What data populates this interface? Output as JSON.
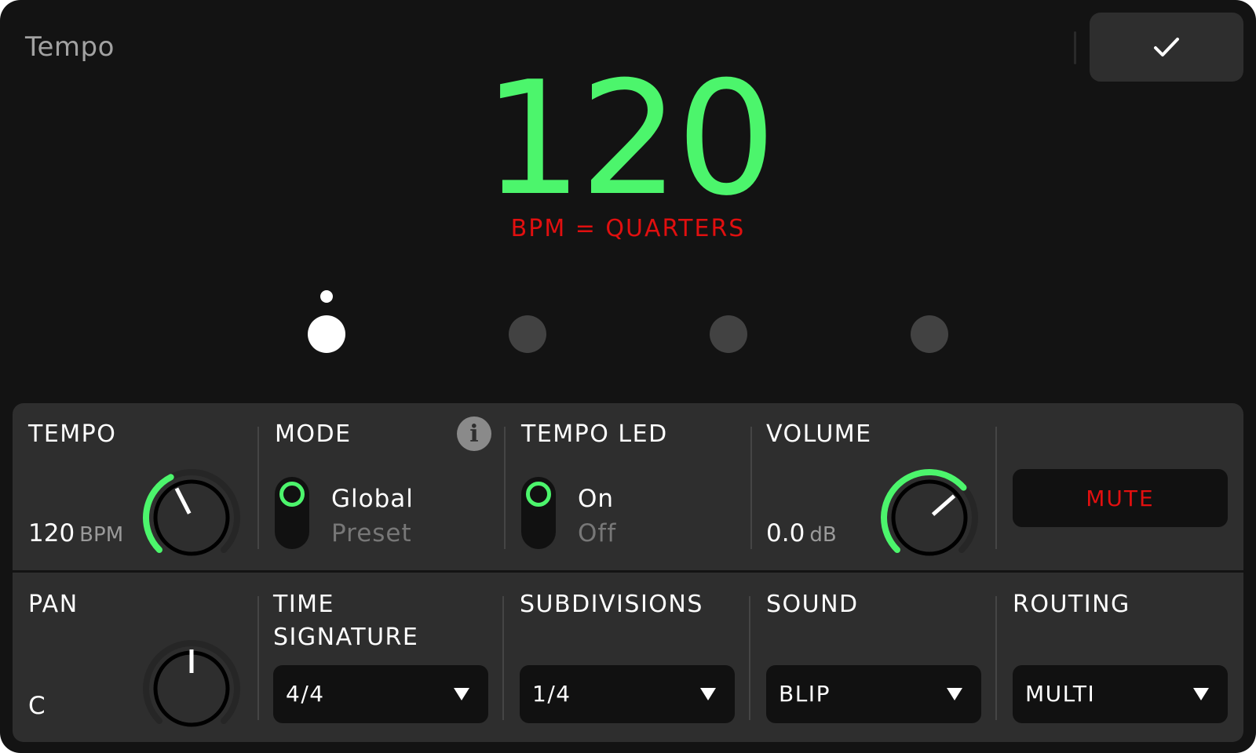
{
  "header": {
    "title": "Tempo",
    "confirm_icon": "check-icon"
  },
  "display": {
    "tempo": "120",
    "note": "BPM = QUARTERS",
    "beats": {
      "count": 4,
      "active_index": 0
    }
  },
  "colors": {
    "accent": "#4cf56c",
    "warning": "#e10f0f",
    "panel": "#2e2e2e",
    "background": "#131313"
  },
  "controls": {
    "tempo": {
      "label": "TEMPO",
      "value": "120",
      "unit": "BPM",
      "level": 0.4
    },
    "mode": {
      "label": "MODE",
      "option_selected": "Global",
      "option_other": "Preset",
      "info_icon": "info-icon"
    },
    "tempo_led": {
      "label": "TEMPO LED",
      "option_selected": "On",
      "option_other": "Off"
    },
    "volume": {
      "label": "VOLUME",
      "value": "0.0",
      "unit": "dB",
      "level": 0.68
    },
    "mute": {
      "label": "MUTE"
    },
    "pan": {
      "label": "PAN",
      "value": "C",
      "level": 0.5
    },
    "time_signature": {
      "label_line1": "TIME",
      "label_line2": "SIGNATURE",
      "value": "4/4"
    },
    "subdivisions": {
      "label": "SUBDIVISIONS",
      "value": "1/4"
    },
    "sound": {
      "label": "SOUND",
      "value": "BLIP"
    },
    "routing": {
      "label": "ROUTING",
      "value": "MULTI"
    }
  }
}
